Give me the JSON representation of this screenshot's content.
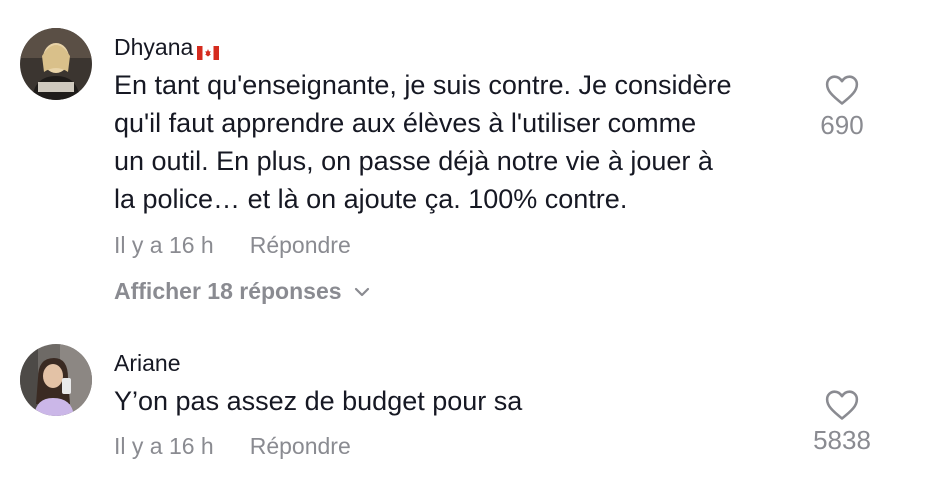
{
  "comments": [
    {
      "username": "Dhyana",
      "flag": "flag-canada-icon",
      "text_lines": [
        "En tant qu'enseignante, je suis contre. Je considère",
        "qu'il faut apprendre aux élèves à l'utiliser comme",
        "un outil. En plus, on passe déjà notre vie à jouer à",
        "la police… et là on ajoute ça. 100% contre."
      ],
      "time": "Il y a 16 h",
      "reply_label": "Répondre",
      "likes": "690",
      "view_replies_label": "Afficher 18 réponses"
    },
    {
      "username": "Ariane",
      "text_lines": [
        "Y’on pas assez de budget pour sa"
      ],
      "time": "Il y a 16 h",
      "reply_label": "Répondre",
      "likes": "5838"
    }
  ],
  "colors": {
    "text_primary": "#161823",
    "text_secondary": "#8a8b91",
    "flag_red": "#d52b1e"
  }
}
